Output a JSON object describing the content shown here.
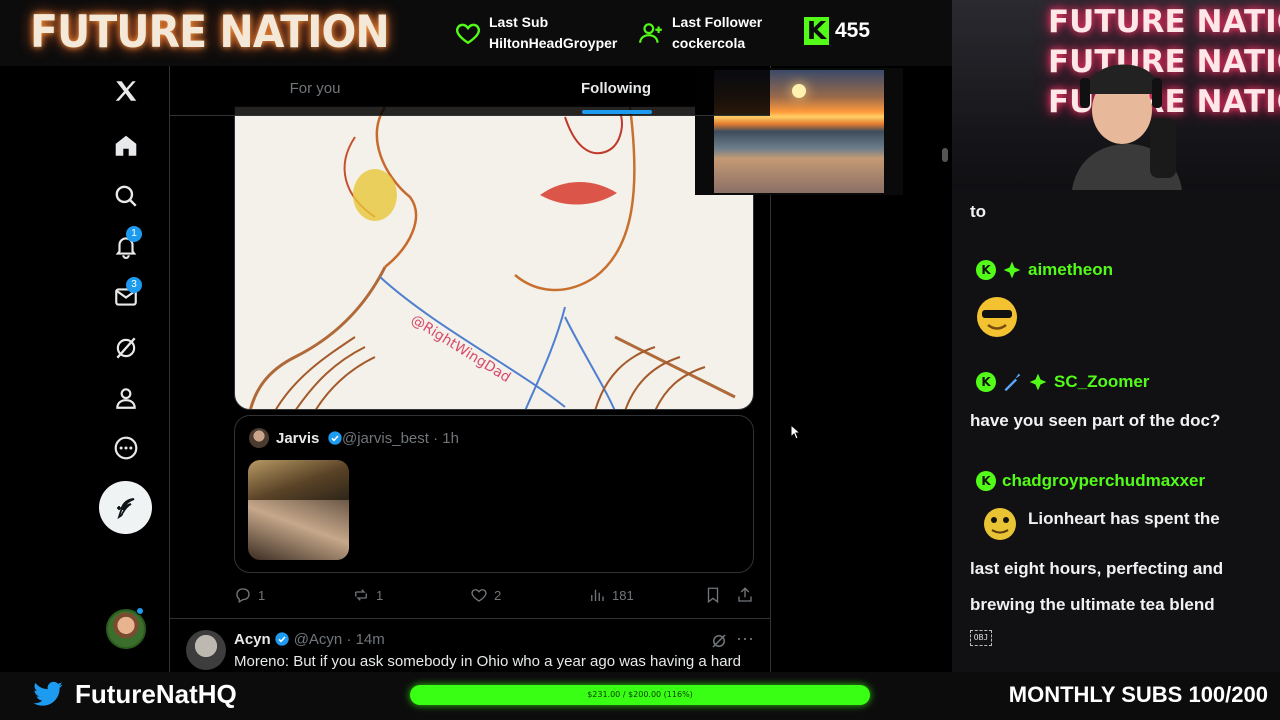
{
  "overlay": {
    "brand": "FUTURE NATION",
    "last_sub_label": "Last Sub",
    "last_sub_value": "HiltonHeadGroyper",
    "last_follower_label": "Last Follower",
    "last_follower_value": "cockercola",
    "kick_logo": "K",
    "kick_count": "455",
    "cam_sign_line1": "FUTURE NATION",
    "cam_sign_line2": "FUTURE NATION",
    "cam_sign_line3": "FUTURE NATION",
    "twitter_handle": "FutureNatHQ",
    "goal_text": "$231.00 / $200.00 (116%)",
    "goal_progress": 1.0,
    "monthly_subs": "MONTHLY SUBS 100/200",
    "accent": "#53fc18"
  },
  "x": {
    "nav": {
      "notifications_badge": "1",
      "messages_badge": "3"
    },
    "tabs": {
      "for_you": "For you",
      "following": "Following"
    },
    "drawing": {
      "watermark": "@RightWingDad"
    },
    "quote": {
      "name": "Jarvis",
      "handle": "@jarvis_best · 1h"
    },
    "actions": {
      "replies": "1",
      "reposts": "1",
      "likes": "2",
      "views": "181"
    },
    "tweet2": {
      "name": "Acyn",
      "handle": "@Acyn · 14m",
      "text": "Moreno: But if you ask somebody in Ohio who a year ago was having a hard"
    },
    "accent": "#1d9bf0"
  },
  "chat": {
    "messages": [
      {
        "text": "to"
      },
      {
        "user": "aimetheon",
        "emote": "cool-face-emote"
      },
      {
        "user": "SC_Zoomer",
        "text": "have you seen part of the doc?"
      },
      {
        "user": "chadgroyperchudmaxxer",
        "text_line1": "Lionheart has spent the",
        "text_line2": "last eight hours, perfecting and",
        "text_line3": "brewing the ultimate tea blend"
      }
    ],
    "obj_glyph": "OBJ",
    "badge_letter": "K"
  }
}
